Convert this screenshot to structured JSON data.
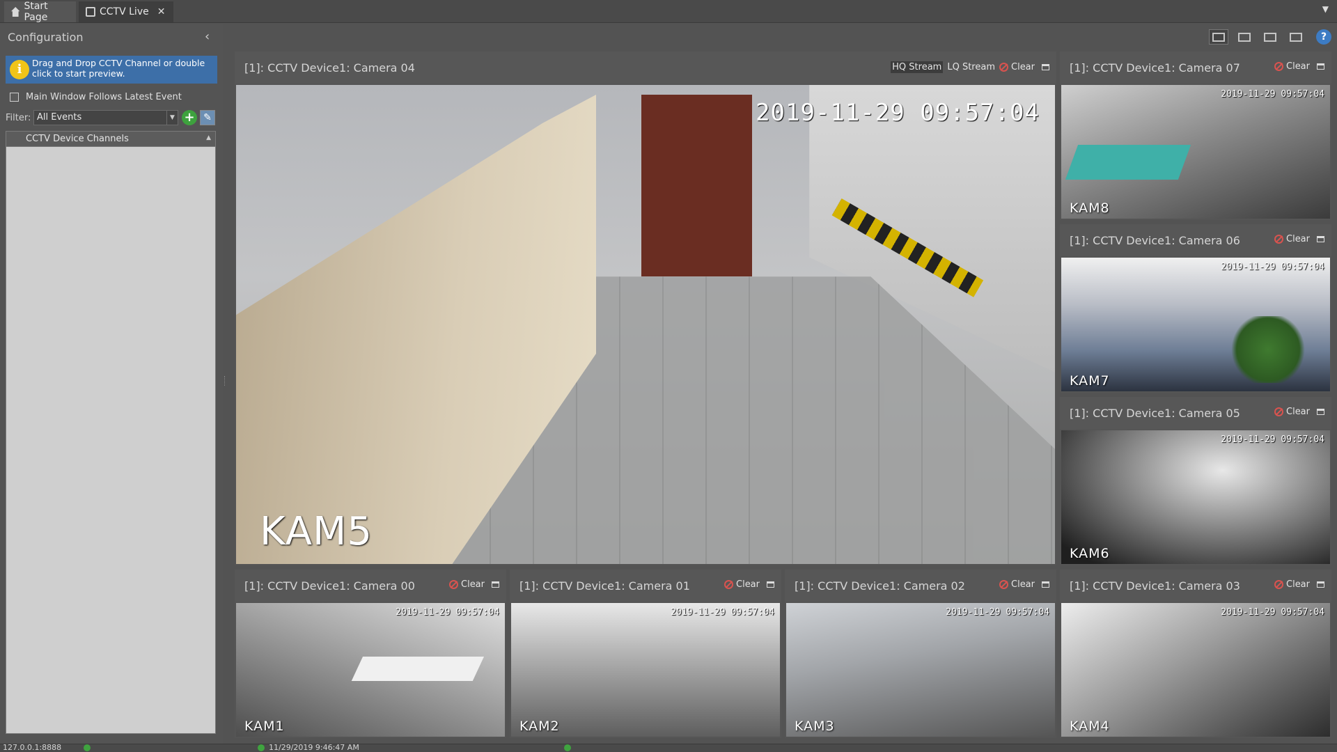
{
  "tabs": [
    {
      "label": "Start Page",
      "icon": "home-icon"
    },
    {
      "label": "CCTV Live",
      "icon": "monitor-icon",
      "active": true
    }
  ],
  "config": {
    "title": "Configuration",
    "info_text": "Drag and Drop CCTV Channel or double click to start preview.",
    "follow_label": "Main Window Follows Latest Event",
    "filter_label": "Filter:",
    "filter_value": "All Events",
    "channels_header": "CCTV Device Channels"
  },
  "tiles": {
    "cam04": {
      "title": "[1]: CCTV Device1: Camera 04",
      "stamp": "2019-11-29 09:57:04",
      "label": "KAM5",
      "hq": "HQ Stream",
      "lq": "LQ Stream",
      "clear": "Clear"
    },
    "cam07": {
      "title": "[1]: CCTV Device1: Camera 07",
      "stamp": "2019-11-29 09:57:04",
      "label": "KAM8",
      "clear": "Clear"
    },
    "cam06": {
      "title": "[1]: CCTV Device1: Camera 06",
      "stamp": "2019-11-29 09:57:04",
      "label": "KAM7",
      "clear": "Clear"
    },
    "cam05": {
      "title": "[1]: CCTV Device1: Camera 05",
      "stamp": "2019-11-29 09:57:04",
      "label": "KAM6",
      "clear": "Clear"
    },
    "cam00": {
      "title": "[1]: CCTV Device1: Camera 00",
      "stamp": "2019-11-29 09:57:04",
      "label": "KAM1",
      "clear": "Clear"
    },
    "cam01": {
      "title": "[1]: CCTV Device1: Camera 01",
      "stamp": "2019-11-29 09:57:04",
      "label": "KAM2",
      "clear": "Clear"
    },
    "cam02": {
      "title": "[1]: CCTV Device1: Camera 02",
      "stamp": "2019-11-29 09:57:04",
      "label": "KAM3",
      "clear": "Clear"
    },
    "cam03": {
      "title": "[1]: CCTV Device1: Camera 03",
      "stamp": "2019-11-29 09:57:04",
      "label": "KAM4",
      "clear": "Clear"
    }
  },
  "statusbar": {
    "address": "127.0.0.1:8888",
    "item2": "",
    "item3": "11/29/2019 9:46:47 AM",
    "item4": ""
  },
  "colors": {
    "info_bg": "#3d6fa8",
    "clear_icon": "#d9534f",
    "help": "#3d7cc4",
    "add": "#3ea23e"
  }
}
